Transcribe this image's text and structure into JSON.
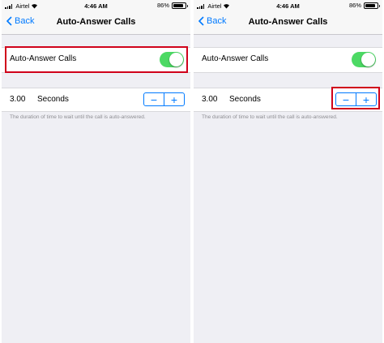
{
  "status": {
    "carrier": "Airtel",
    "time": "4:46 AM",
    "battery": "86%",
    "battery_level": 0.86
  },
  "nav": {
    "back_label": "Back",
    "title": "Auto-Answer Calls"
  },
  "settings": {
    "toggle_label": "Auto-Answer Calls",
    "toggle_on": true,
    "seconds_value": "3.00",
    "seconds_unit": "Seconds",
    "minus_symbol": "−",
    "plus_symbol": "+",
    "description": "The duration of time to wait until the call is auto-answered."
  },
  "colors": {
    "accent": "#007aff",
    "toggle_on": "#4cd964",
    "highlight": "#d0021b",
    "background": "#efeff4"
  }
}
